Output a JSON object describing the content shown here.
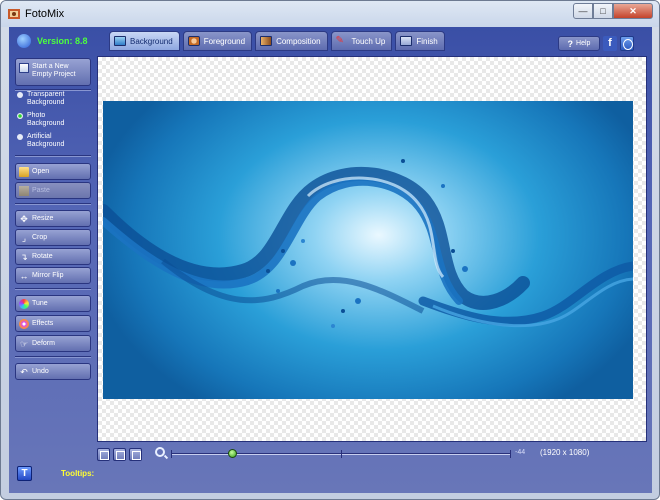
{
  "window": {
    "title": "FotoMix"
  },
  "version": "Version: 8.8",
  "tabs": [
    {
      "label": "Background",
      "active": true,
      "icon": "landscape-icon"
    },
    {
      "label": "Foreground",
      "active": false,
      "icon": "person-icon"
    },
    {
      "label": "Composition",
      "active": false,
      "icon": "composition-icon"
    },
    {
      "label": "Touch Up",
      "active": false,
      "icon": "pencil-icon"
    },
    {
      "label": "Finish",
      "active": false,
      "icon": "finish-icon"
    }
  ],
  "help_label": "Help",
  "sidebar": {
    "new_project_line1": "Start a New",
    "new_project_line2": "Empty Project",
    "radios": [
      {
        "line1": "Transparent",
        "line2": "Background",
        "selected": false
      },
      {
        "line1": "Photo",
        "line2": "Background",
        "selected": true
      },
      {
        "line1": "Artificial",
        "line2": "Background",
        "selected": false
      }
    ],
    "open": "Open",
    "paste": "Paste",
    "resize": "Resize",
    "crop": "Crop",
    "rotate": "Rotate",
    "mirror": "Mirror Flip",
    "tune": "Tune",
    "effects": "Effects",
    "deform": "Deform",
    "undo": "Undo"
  },
  "tooltips_label": "Tooltips:",
  "zoom": {
    "value": "-44",
    "fraction": 0.18
  },
  "resolution": "(1920 x 1080)",
  "colors": {
    "accent": "#4CFF3E",
    "tooltip": "#FFFF33",
    "panel": "#4A5CB0"
  }
}
